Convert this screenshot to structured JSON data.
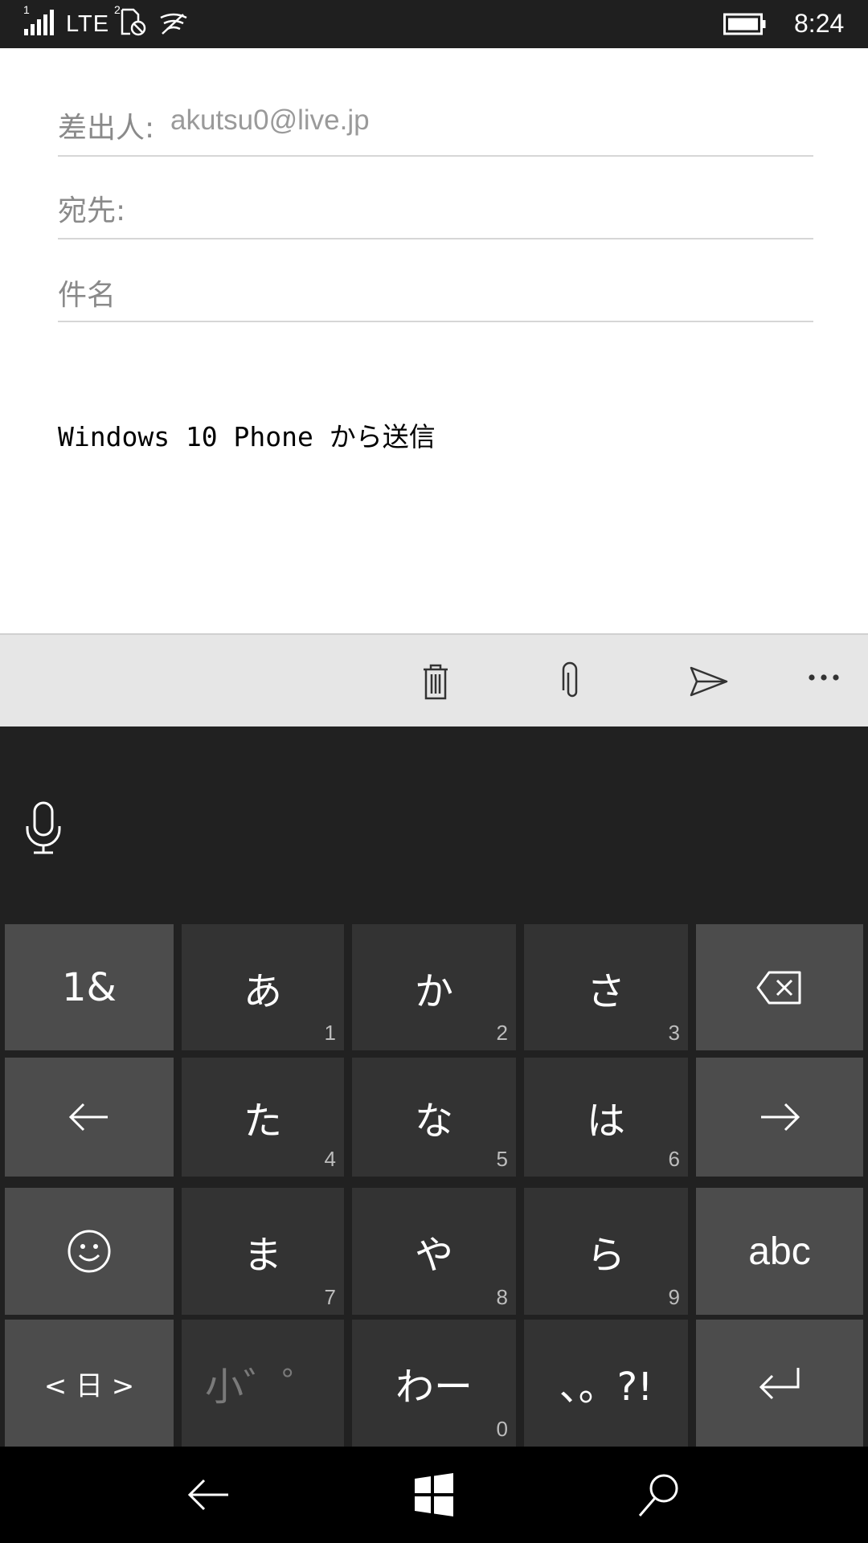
{
  "status_bar": {
    "sim1_index": "1",
    "network": "LTE",
    "sim2_index": "2",
    "time": "8:24",
    "icons": [
      "signal-icon",
      "sim-no-card-icon",
      "wifi-icon",
      "battery-icon"
    ]
  },
  "compose": {
    "from_label": "差出人:",
    "from_value": "akutsu0@live.jp",
    "to_label": "宛先:",
    "subject_placeholder": "件名",
    "body_signature": "Windows 10 Phone から送信"
  },
  "app_bar": {
    "icons": [
      "trash-icon",
      "paperclip-icon",
      "send-icon",
      "more-icon"
    ]
  },
  "keyboard": {
    "row1": {
      "k1": "1&",
      "k2": "あ",
      "k2n": "1",
      "k3": "か",
      "k3n": "2",
      "k4": "さ",
      "k4n": "3"
    },
    "row2": {
      "k2": "た",
      "k2n": "4",
      "k3": "な",
      "k3n": "5",
      "k4": "は",
      "k4n": "6"
    },
    "row3": {
      "k2": "ま",
      "k2n": "7",
      "k3": "や",
      "k3n": "8",
      "k4": "ら",
      "k4n": "9",
      "k5": "abc"
    },
    "row4": {
      "k1": "< 日 >",
      "k2": "小゛゜",
      "k3": "わー",
      "k3n": "0",
      "k4": "、。?!"
    }
  },
  "colors": {
    "status_bg": "#1f1f1f",
    "appbar_bg": "#e6e6e6",
    "keyboard_bg": "#212121",
    "key_bg": "#333333",
    "fn_key_bg": "#4c4c4c",
    "nav_bg": "#000000"
  }
}
